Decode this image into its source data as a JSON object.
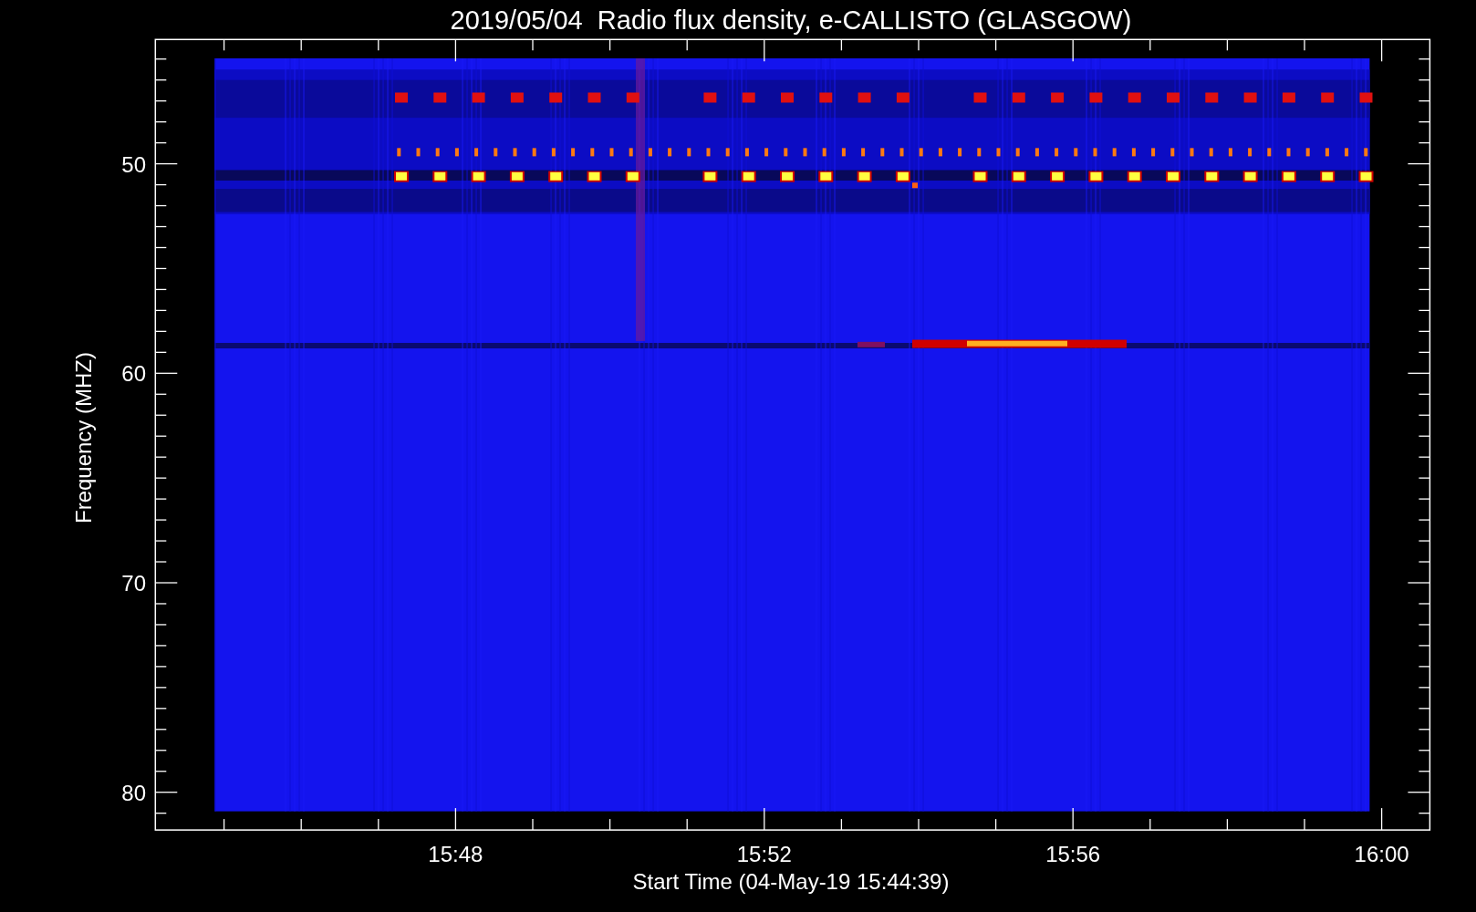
{
  "title": "2019/05/04  Radio flux density, e-CALLISTO (GLASGOW)",
  "xaxis": {
    "label": "Start Time (04-May-19 15:44:39)",
    "ticks": [
      "15:48",
      "15:52",
      "15:56",
      "16:00"
    ]
  },
  "yaxis": {
    "label": "Frequency (MHZ)",
    "ticks": [
      "50",
      "60",
      "70",
      "80"
    ]
  }
}
